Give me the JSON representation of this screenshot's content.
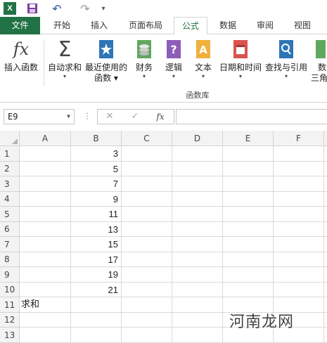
{
  "qat": {
    "logo_text": "X",
    "undo_glyph": "↶",
    "redo_glyph": "↷",
    "more_glyph": "▾"
  },
  "tabs": [
    {
      "label": "文件"
    },
    {
      "label": "开始"
    },
    {
      "label": "插入"
    },
    {
      "label": "页面布局"
    },
    {
      "label": "公式"
    },
    {
      "label": "数据"
    },
    {
      "label": "审阅"
    },
    {
      "label": "视图"
    }
  ],
  "ribbon": {
    "buttons": [
      {
        "label": "插入函数",
        "icon": "fx-icon"
      },
      {
        "label": "自动求和",
        "icon": "sigma-icon"
      },
      {
        "label": "最近使用的",
        "label2": "函数",
        "icon": "star-book-icon"
      },
      {
        "label": "财务",
        "icon": "coins-icon"
      },
      {
        "label": "逻辑",
        "icon": "question-book-icon"
      },
      {
        "label": "文本",
        "icon": "text-book-icon"
      },
      {
        "label": "日期和时间",
        "icon": "calendar-icon"
      },
      {
        "label": "查找与引用",
        "icon": "magnifier-book-icon"
      },
      {
        "label": "数",
        "label2": "三角",
        "icon": "math-book-icon"
      }
    ],
    "group_label": "函数库"
  },
  "formula_bar": {
    "name_box": "E9",
    "cancel_glyph": "✕",
    "enter_glyph": "✓",
    "fx_label": "fx",
    "dots": "⋮",
    "formula_value": ""
  },
  "grid": {
    "columns": [
      "A",
      "B",
      "C",
      "D",
      "E",
      "F"
    ],
    "rows": [
      {
        "n": "1",
        "a": "",
        "b": "3"
      },
      {
        "n": "2",
        "a": "",
        "b": "5"
      },
      {
        "n": "3",
        "a": "",
        "b": "7"
      },
      {
        "n": "4",
        "a": "",
        "b": "9"
      },
      {
        "n": "5",
        "a": "",
        "b": "11"
      },
      {
        "n": "6",
        "a": "",
        "b": "13"
      },
      {
        "n": "7",
        "a": "",
        "b": "15"
      },
      {
        "n": "8",
        "a": "",
        "b": "17"
      },
      {
        "n": "9",
        "a": "",
        "b": "19"
      },
      {
        "n": "10",
        "a": "",
        "b": "21"
      },
      {
        "n": "11",
        "a": "求和",
        "b": ""
      },
      {
        "n": "12",
        "a": "",
        "b": ""
      },
      {
        "n": "13",
        "a": "",
        "b": ""
      }
    ]
  },
  "watermark": "河南龙网",
  "colors": {
    "excel_green": "#217346",
    "accent_blue": "#2b579a"
  }
}
